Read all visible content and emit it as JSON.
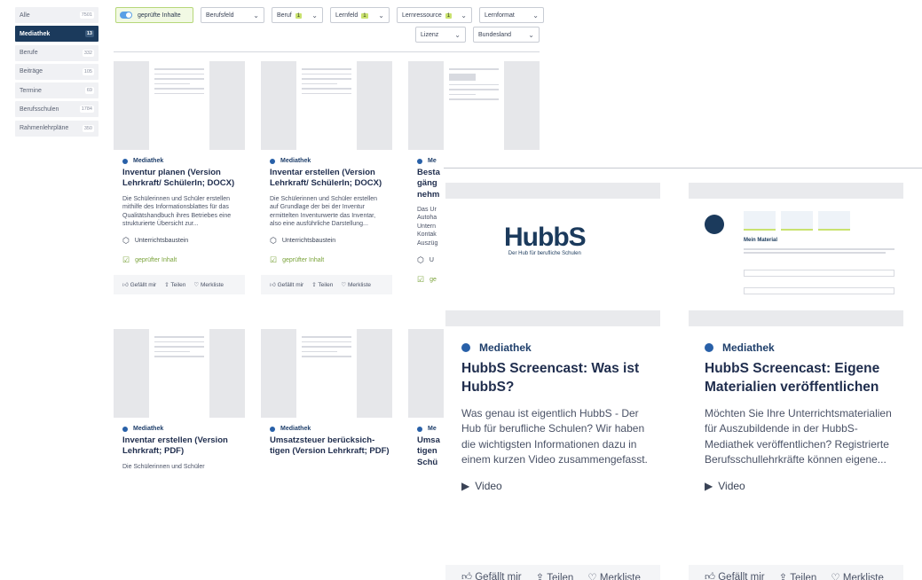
{
  "sidebar": {
    "items": [
      {
        "label": "Alle",
        "count": "7501"
      },
      {
        "label": "Mediathek",
        "count": "13"
      },
      {
        "label": "Berufe",
        "count": "332"
      },
      {
        "label": "Beiträge",
        "count": "105"
      },
      {
        "label": "Termine",
        "count": "69"
      },
      {
        "label": "Berufsschulen",
        "count": "1784"
      },
      {
        "label": "Rahmenlehrpläne",
        "count": "350"
      }
    ]
  },
  "filters": {
    "toggle_label": "geprüfte Inhalte",
    "dropdowns": [
      {
        "label": "Berufsfeld",
        "badge": ""
      },
      {
        "label": "Beruf",
        "badge": "1"
      },
      {
        "label": "Lernfeld",
        "badge": "1"
      },
      {
        "label": "Lernressource",
        "badge": "1"
      },
      {
        "label": "Lernformat",
        "badge": ""
      },
      {
        "label": "Lizenz",
        "badge": ""
      },
      {
        "label": "Bundesland",
        "badge": ""
      }
    ]
  },
  "actions": {
    "like": "Gefällt mir",
    "share": "Teilen",
    "bookmark": "Merkliste"
  },
  "cards": [
    {
      "category": "Mediathek",
      "title": "Inventur planen (Version Lehrkraft/ SchülerIn; DOCX)",
      "desc": "Die Schülerinnen und Schüler erstellen mithilfe des Informationsblattes für das Qualitätshandbuch ihres Betriebes eine strukturierte Übersicht zur...",
      "type": "Unterrichtsbaustein",
      "verified": "geprüfter Inhalt"
    },
    {
      "category": "Mediathek",
      "title": "Inventar erstellen (Version Lehrkraft/ SchülerIn; DOCX)",
      "desc": "Die Schülerinnen und Schüler erstellen auf Grundlage der bei der Inventur ermittelten Inventurwerte das Inventar, also eine ausführliche Darstellung...",
      "type": "Unterrichtsbaustein",
      "verified": "geprüfter Inhalt"
    },
    {
      "category": "Me",
      "title": "Besta gäng nehm",
      "desc": "Das Ur Autoha Untern Kontak Auszüg",
      "type": "U",
      "verified": "ge"
    },
    {
      "category": "Mediathek",
      "title": "Inventar erstellen (Version Lehrkraft; PDF)",
      "desc": "Die Schülerinnen und Schüler"
    },
    {
      "category": "Mediathek",
      "title": "Umsatzsteuer berücksich- tigen (Version Lehrkraft; PDF)",
      "desc": ""
    },
    {
      "category": "Me",
      "title": "Umsa tigen Schü",
      "desc": ""
    }
  ],
  "big_cards": [
    {
      "category": "Mediathek",
      "title": "HubbS Screencast: Was ist HubbS?",
      "desc": "Was genau ist eigentlich HubbS - Der Hub für berufliche Schulen? Wir haben die wichtigsten Informationen dazu in einem kurzen Video zusammengefasst.",
      "type": "Video",
      "logo_word": "HubbS",
      "logo_sub": "Der Hub für berufliche Schulen"
    },
    {
      "category": "Mediathek",
      "title": "HubbS Screencast: Eigene Materialien veröffentlichen",
      "desc": "Möchten Sie Ihre Unterrichtsmaterialien für Auszubildende in der HubbS-Mediathek veröffentlichen? Registrierte Berufsschullehrkräfte können eigene...",
      "type": "Video",
      "shot_heading": "Mein Material"
    }
  ]
}
